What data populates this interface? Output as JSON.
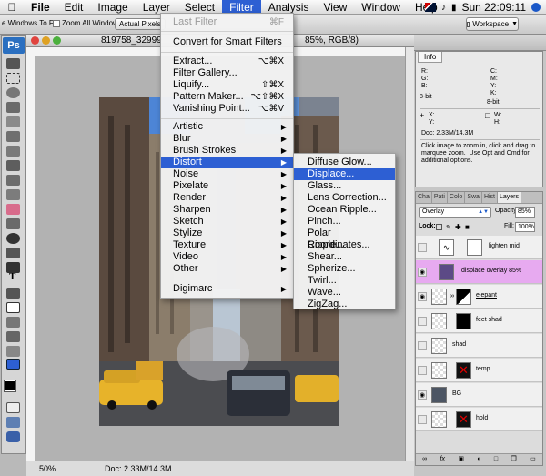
{
  "menubar": {
    "apple": "",
    "items": [
      "File",
      "Edit",
      "Image",
      "Layer",
      "Select",
      "Filter",
      "Analysis",
      "View",
      "Window",
      "Help"
    ],
    "active_index": 5,
    "clock": "Sun 22:09:11"
  },
  "options_bar": {
    "resize_label": "e Windows To Fit",
    "zoom_all_label": "Zoom All Windows",
    "actual_pixels": "Actual Pixels",
    "workspace": "Workspace"
  },
  "tools": {
    "logo": "Ps"
  },
  "document": {
    "title": "819758_32999",
    "title_mode": "85%, RGB/8)",
    "zoom": "50%",
    "doc_size": "Doc: 2.33M/14.3M"
  },
  "filter_menu": {
    "last_filter": "Last Filter",
    "last_filter_shortcut": "⌘F",
    "convert_smart": "Convert for Smart Filters",
    "items": [
      {
        "label": "Extract...",
        "shortcut": "⌥⌘X"
      },
      {
        "label": "Filter Gallery...",
        "shortcut": ""
      },
      {
        "label": "Liquify...",
        "shortcut": "⇧⌘X"
      },
      {
        "label": "Pattern Maker...",
        "shortcut": "⌥⇧⌘X"
      },
      {
        "label": "Vanishing Point...",
        "shortcut": "⌥⌘V"
      }
    ],
    "categories": [
      "Artistic",
      "Blur",
      "Brush Strokes",
      "Distort",
      "Noise",
      "Pixelate",
      "Render",
      "Sharpen",
      "Sketch",
      "Stylize",
      "Texture",
      "Video",
      "Other"
    ],
    "highlighted_category": "Distort",
    "digimarc": "Digimarc"
  },
  "distort_menu": {
    "items": [
      "Diffuse Glow...",
      "Displace...",
      "Glass...",
      "Lens Correction...",
      "Ocean Ripple...",
      "Pinch...",
      "Polar Coordinates...",
      "Ripple...",
      "Shear...",
      "Spherize...",
      "Twirl...",
      "Wave...",
      "ZigZag..."
    ],
    "highlighted": "Displace..."
  },
  "info_panel": {
    "tab": "Info",
    "rgb": "R:\nG:\nB:",
    "cmyk": "C:\nM:\nY:\nK:",
    "bit_left": "8-bit",
    "bit_right": "8-bit",
    "xy": "X:\nY:",
    "wh": "W:\nH:",
    "doc": "Doc: 2.33M/14.3M",
    "hint": "Click image to zoom in, click and drag to\nmarquee zoom.  Use Opt and Cmd for\nadditional options."
  },
  "layers_panel": {
    "tabs": [
      "Cha",
      "Pati",
      "Colo",
      "Swa",
      "Hist",
      "Layers"
    ],
    "blend_mode": "Overlay",
    "opacity_label": "Opacity:",
    "opacity": "85%",
    "lock_label": "Lock:",
    "fill_label": "Fill:",
    "fill": "100%",
    "layers": [
      {
        "name": "lighten mid",
        "visible": false,
        "selected": false,
        "mask": "white",
        "underline": false
      },
      {
        "name": "displace overlay 85%",
        "visible": true,
        "selected": true,
        "mask": "none",
        "underline": false
      },
      {
        "name": "elepant",
        "visible": true,
        "selected": false,
        "mask": "black-white",
        "underline": true
      },
      {
        "name": "feet shad",
        "visible": false,
        "selected": false,
        "mask": "black",
        "underline": false
      },
      {
        "name": "shad",
        "visible": false,
        "selected": false,
        "mask": "none",
        "underline": false
      },
      {
        "name": "temp",
        "visible": false,
        "selected": false,
        "mask": "red-x",
        "underline": false
      },
      {
        "name": "BG",
        "visible": true,
        "selected": false,
        "mask": "none",
        "underline": false
      },
      {
        "name": "hold",
        "visible": false,
        "selected": false,
        "mask": "red-x",
        "underline": false
      }
    ],
    "footer_icons": [
      "link-icon",
      "fx-icon",
      "mask-icon",
      "adjustment-icon",
      "folder-icon",
      "new-layer-icon",
      "trash-icon"
    ]
  }
}
